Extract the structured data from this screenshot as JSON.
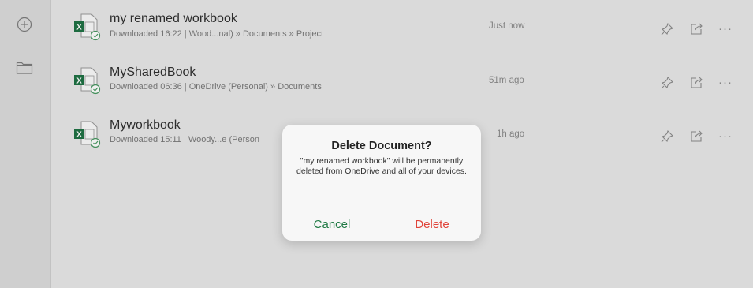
{
  "sidebar": {
    "items": [
      {
        "icon": "plus-circle-icon"
      },
      {
        "icon": "folder-icon"
      }
    ]
  },
  "files": [
    {
      "name": "my renamed workbook",
      "subtitle": "Downloaded 16:22 | Wood...nal) » Documents » Project",
      "time": "Just now",
      "icon": "excel-file-icon"
    },
    {
      "name": "MySharedBook",
      "subtitle": "Downloaded 06:36 | OneDrive (Personal) » Documents",
      "time": "51m ago",
      "icon": "excel-file-icon"
    },
    {
      "name": "Myworkbook",
      "subtitle": "Downloaded 15:11 | Woody...e (Person",
      "time": "1h ago",
      "icon": "excel-file-icon"
    }
  ],
  "actions": {
    "pin_icon": "pin-icon",
    "share_icon": "share-icon",
    "more": "···"
  },
  "dialog": {
    "title": "Delete Document?",
    "message": "\"my renamed workbook\" will be permanently deleted from OneDrive and all of your devices.",
    "cancel": "Cancel",
    "delete": "Delete"
  },
  "colors": {
    "excel_green": "#1f7244",
    "cancel": "#1f7a44",
    "delete": "#e0443a"
  }
}
